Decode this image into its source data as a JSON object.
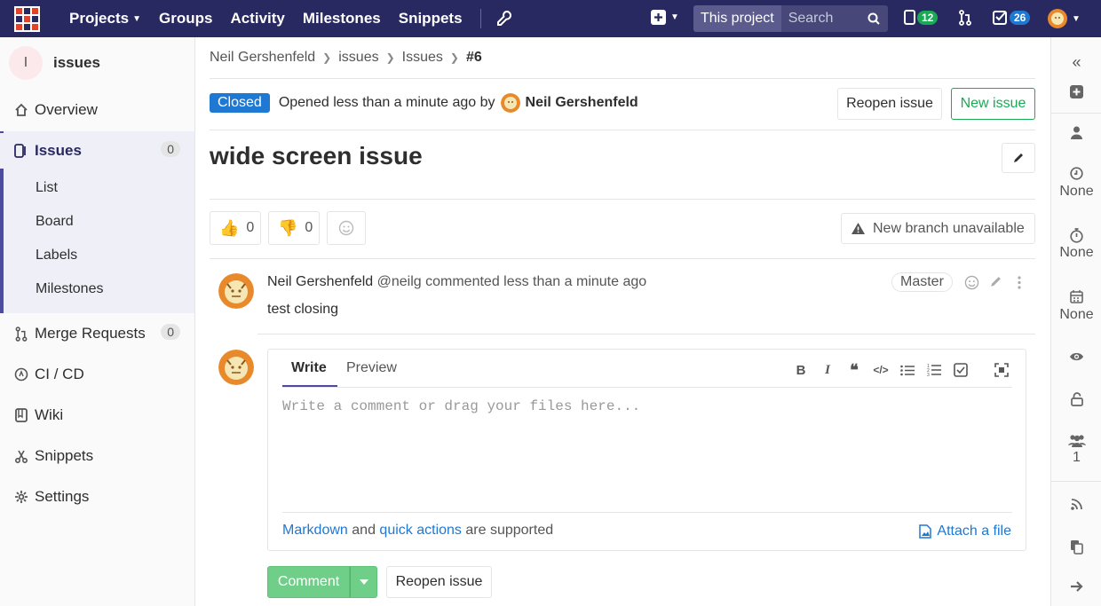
{
  "topnav": {
    "links": [
      "Projects",
      "Groups",
      "Activity",
      "Milestones",
      "Snippets"
    ],
    "search_scope": "This project",
    "search_placeholder": "Search",
    "issues_count": "12",
    "todos_count": "26",
    "colors": {
      "bar": "#292961",
      "issues_badge": "#1aaa55",
      "todos_badge": "#1f78d1"
    }
  },
  "sidebar": {
    "project_initial": "I",
    "project_name": "issues",
    "items": [
      {
        "label": "Overview",
        "icon": "home-icon"
      },
      {
        "label": "Issues",
        "icon": "issues-icon",
        "count": "0"
      },
      {
        "label": "Merge Requests",
        "icon": "merge-request-icon",
        "count": "0"
      },
      {
        "label": "CI / CD",
        "icon": "rocket-icon"
      },
      {
        "label": "Wiki",
        "icon": "book-icon"
      },
      {
        "label": "Snippets",
        "icon": "scissors-icon"
      },
      {
        "label": "Settings",
        "icon": "gear-icon"
      }
    ],
    "sub_items": [
      "List",
      "Board",
      "Labels",
      "Milestones"
    ]
  },
  "breadcrumb": {
    "items": [
      "Neil Gershenfeld",
      "issues",
      "Issues"
    ],
    "current": "#6"
  },
  "issue": {
    "status": "Closed",
    "opened_text": "Opened less than a minute ago by",
    "author": "Neil Gershenfeld",
    "reopen_label": "Reopen issue",
    "new_issue_label": "New issue",
    "title": "wide screen issue",
    "thumbs_up": "0",
    "thumbs_down": "0",
    "new_branch_label": "New branch unavailable"
  },
  "note": {
    "author": "Neil Gershenfeld",
    "meta": "@neilg commented less than a minute ago",
    "body": "test closing",
    "role": "Master"
  },
  "editor": {
    "write_tab": "Write",
    "preview_tab": "Preview",
    "placeholder": "Write a comment or drag your files here...",
    "markdown_link": "Markdown",
    "and_text": "and",
    "quick_actions_link": "quick actions",
    "supported_text": "are supported",
    "attach_label": "Attach a file",
    "comment_label": "Comment",
    "reopen_label": "Reopen issue"
  },
  "right_sidebar": {
    "milestone": "None",
    "time_tracking": "None",
    "due_date": "None",
    "participants": "1"
  }
}
